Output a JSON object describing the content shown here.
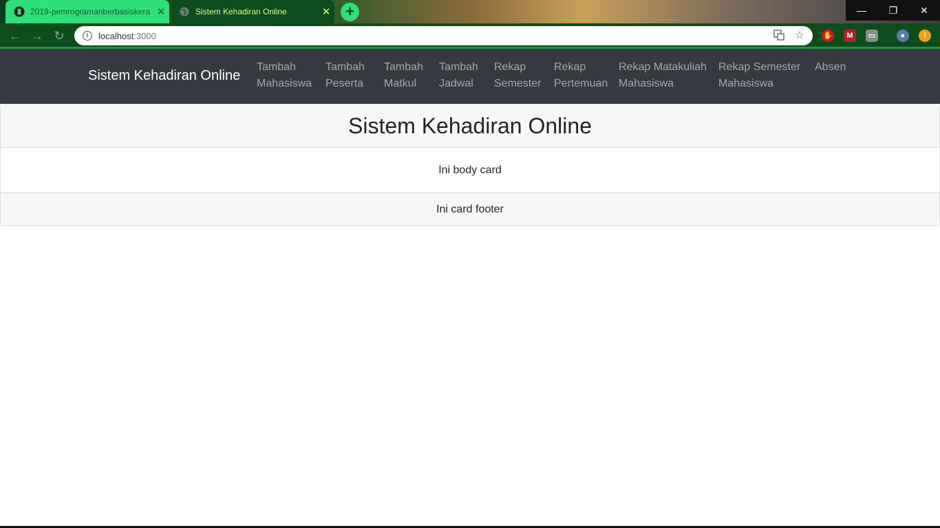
{
  "browser": {
    "tabs": [
      {
        "title": "2019-pemrogramanberbasiskera",
        "icon": "github-icon",
        "active": false
      },
      {
        "title": "Sistem Kehadiran Online",
        "icon": "globe-icon",
        "active": true
      }
    ],
    "new_tab_label": "+",
    "window_controls": {
      "minimize": "—",
      "restore": "❐",
      "close": "✕"
    },
    "address": {
      "host": "localhost",
      "port": ":3000"
    },
    "colors": {
      "tab_active": "#0d4d1c",
      "tab_inactive": "#2ee07a",
      "toolbar": "#0d4d1c"
    }
  },
  "navbar": {
    "brand": "Sistem Kehadiran Online",
    "links": [
      {
        "line1": "Tambah",
        "line2": "Mahasiswa"
      },
      {
        "line1": "Tambah",
        "line2": "Peserta"
      },
      {
        "line1": "Tambah",
        "line2": "Matkul"
      },
      {
        "line1": "Tambah",
        "line2": "Jadwal"
      },
      {
        "line1": "Rekap",
        "line2": "Semester"
      },
      {
        "line1": "Rekap",
        "line2": "Pertemuan"
      },
      {
        "line1": "Rekap Matakuliah",
        "line2": "Mahasiswa"
      },
      {
        "line1": "Rekap Semester",
        "line2": "Mahasiswa"
      },
      {
        "line1": "Absen",
        "line2": ""
      }
    ],
    "background": "#343a40"
  },
  "card": {
    "header": "Sistem Kehadiran Online",
    "body": "Ini body card",
    "footer": "Ini card footer"
  }
}
